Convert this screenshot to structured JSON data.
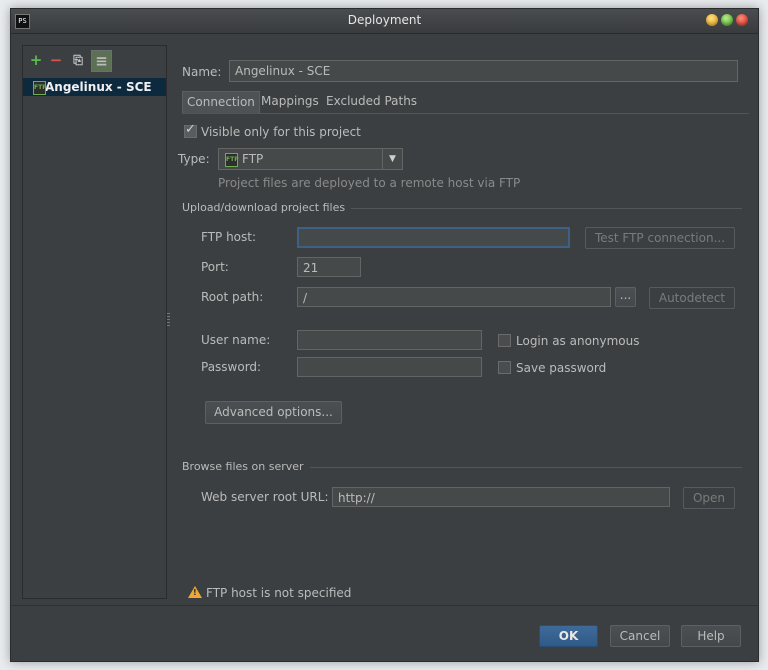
{
  "window": {
    "title": "Deployment",
    "app_icon": "PS"
  },
  "sidebar": {
    "toolbar": {
      "add": "+",
      "remove": "−",
      "copy": "⎘",
      "default": "≡"
    },
    "servers": [
      {
        "label": "Angelinux - SCE",
        "icon": "ftp-icon"
      }
    ]
  },
  "main": {
    "name_label": "Name:",
    "name_value": "Angelinux - SCE",
    "tabs": [
      "Connection",
      "Mappings",
      "Excluded Paths"
    ],
    "visible_only_label": "Visible only for this project",
    "type_label": "Type:",
    "type_value": "FTP",
    "type_desc": "Project files are deployed to a remote host via FTP",
    "upload_section": "Upload/download project files",
    "ftp_host_label": "FTP host:",
    "ftp_host_value": "",
    "test_btn": "Test FTP connection...",
    "port_label": "Port:",
    "port_value": "21",
    "root_label": "Root path:",
    "root_value": "/",
    "browse_btn": "...",
    "autodetect_btn": "Autodetect",
    "user_label": "User name:",
    "user_value": "",
    "anon_label": "Login as anonymous",
    "password_label": "Password:",
    "password_value": "",
    "save_pw_label": "Save password",
    "advanced_btn": "Advanced options...",
    "browse_section": "Browse files on server",
    "web_url_label": "Web server root URL:",
    "web_url_value": "http://",
    "open_btn": "Open",
    "warning": "FTP host is not specified"
  },
  "footer": {
    "ok": "OK",
    "cancel": "Cancel",
    "help": "Help"
  },
  "colors": {
    "bg": "#3c3f41",
    "selection": "#0d293e",
    "accent": "#305a87",
    "warning": "#f0a732"
  }
}
